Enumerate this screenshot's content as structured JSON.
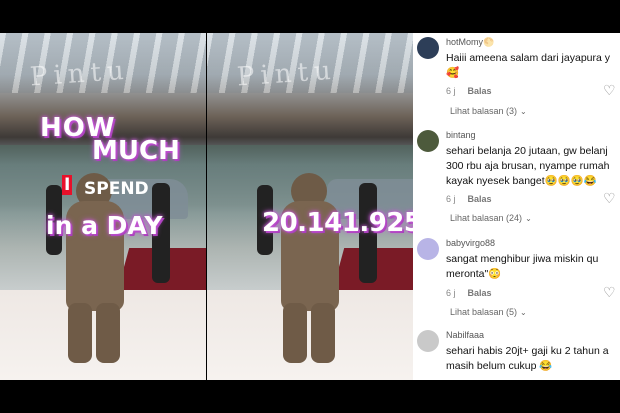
{
  "video_left": {
    "sign_text": "Pintu",
    "overlay": {
      "how": "HOW",
      "much": "MUCH",
      "i": "I",
      "spend": "SPEND",
      "in_a_day": "in a DAY"
    }
  },
  "video_right": {
    "sign_text": "Pintu",
    "overlay": {
      "amount": "20.141.925"
    }
  },
  "comments": [
    {
      "username": "hotMomy🌕",
      "text": "Haiii ameena salam dari jayapura y\n🥰",
      "time": "6 j",
      "reply_label": "Balas",
      "replies": "Lihat balasan (3)",
      "avatar_color": "#2d3e58"
    },
    {
      "username": "bintang",
      "text": "sehari belanja 20 jutaan, gw belanj\n300 rbu aja brusan, nyampe rumah\nkayak nyesek banget🥹🥹🥹😂",
      "time": "6 j",
      "reply_label": "Balas",
      "replies": "Lihat balasan (24)",
      "avatar_color": "#4d5a3c"
    },
    {
      "username": "babyvirgo88",
      "text": "sangat menghibur jiwa miskin qu\nmeronta\"😳",
      "time": "6 j",
      "reply_label": "Balas",
      "replies": "Lihat balasan (5)",
      "avatar_color": "#b8b4e6"
    },
    {
      "username": "Nabilfaaa",
      "text": "sehari habis 20jt+ gaji ku 2 tahun a\nmasih belum cukup 😂",
      "time": "",
      "reply_label": "",
      "replies": "",
      "avatar_color": "#c9c9c9"
    }
  ],
  "icons": {
    "like": "heart-outline-icon",
    "expand": "chevron-down-icon"
  },
  "colors": {
    "overlay_glow": "#c65ad6",
    "spend_box": "#e8102a",
    "carpet": "#7a1b26"
  }
}
